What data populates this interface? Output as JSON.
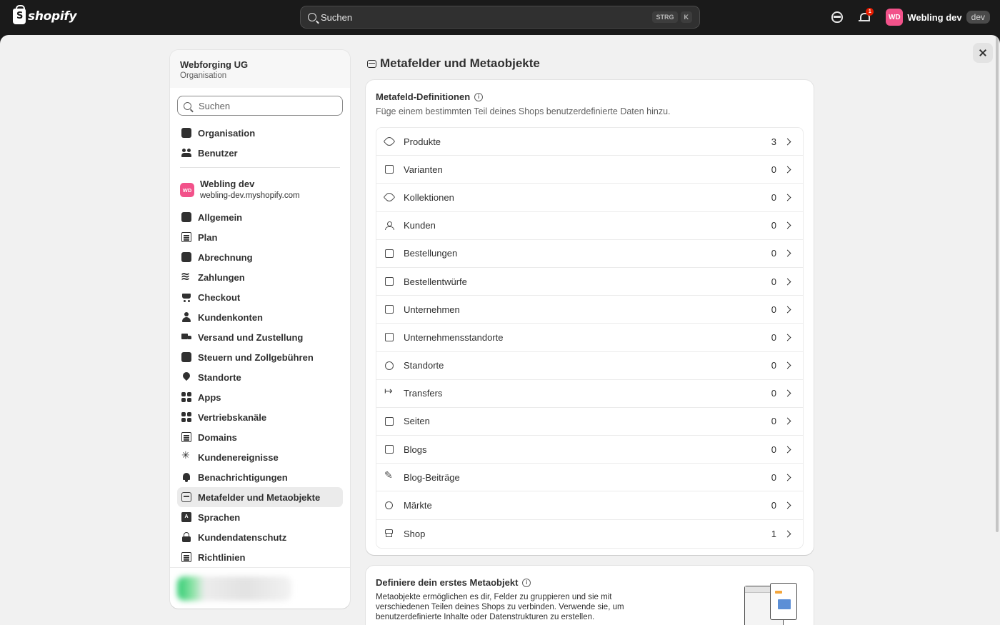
{
  "topbar": {
    "logo_text": "shopify",
    "search_placeholder": "Suchen",
    "shortcut_key1": "STRG",
    "shortcut_key2": "K",
    "notification_count": "1",
    "store_initials": "WD",
    "store_name": "Webling dev",
    "store_badge": "dev"
  },
  "sidebar": {
    "org_name": "Webforging UG",
    "org_sub": "Organisation",
    "search_placeholder": "Suchen",
    "org_items": [
      {
        "label": "Organisation",
        "icon": "building-icon"
      },
      {
        "label": "Benutzer",
        "icon": "users-icon"
      }
    ],
    "store": {
      "initials": "WD",
      "name": "Webling dev",
      "url": "webling-dev.myshopify.com"
    },
    "store_items": [
      {
        "label": "Allgemein",
        "icon": "store-icon"
      },
      {
        "label": "Plan",
        "icon": "plan-icon"
      },
      {
        "label": "Abrechnung",
        "icon": "billing-icon"
      },
      {
        "label": "Zahlungen",
        "icon": "payments-icon"
      },
      {
        "label": "Checkout",
        "icon": "cart-icon"
      },
      {
        "label": "Kundenkonten",
        "icon": "person-icon"
      },
      {
        "label": "Versand und Zustellung",
        "icon": "truck-icon"
      },
      {
        "label": "Steuern und Zollgebühren",
        "icon": "tax-icon"
      },
      {
        "label": "Standorte",
        "icon": "location-icon"
      },
      {
        "label": "Apps",
        "icon": "apps-icon"
      },
      {
        "label": "Vertriebskanäle",
        "icon": "channels-icon"
      },
      {
        "label": "Domains",
        "icon": "domains-icon"
      },
      {
        "label": "Kundenereignisse",
        "icon": "cursor-icon"
      },
      {
        "label": "Benachrichtigungen",
        "icon": "bell-icon"
      },
      {
        "label": "Metafelder und Metaobjekte",
        "icon": "metafields-icon"
      },
      {
        "label": "Sprachen",
        "icon": "language-icon"
      },
      {
        "label": "Kundendatenschutz",
        "icon": "lock-icon"
      },
      {
        "label": "Richtlinien",
        "icon": "policy-icon"
      }
    ]
  },
  "main": {
    "page_title": "Metafelder und Metaobjekte",
    "definitions": {
      "title": "Metafeld-Definitionen",
      "description": "Füge einem bestimmten Teil deines Shops benutzerdefinierte Daten hinzu.",
      "rows": [
        {
          "label": "Produkte",
          "count": "3",
          "icon": "tag-icon"
        },
        {
          "label": "Varianten",
          "count": "0",
          "icon": "variant-icon"
        },
        {
          "label": "Kollektionen",
          "count": "0",
          "icon": "collection-icon"
        },
        {
          "label": "Kunden",
          "count": "0",
          "icon": "person-icon"
        },
        {
          "label": "Bestellungen",
          "count": "0",
          "icon": "inbox-icon"
        },
        {
          "label": "Bestellentwürfe",
          "count": "0",
          "icon": "draft-icon"
        },
        {
          "label": "Unternehmen",
          "count": "0",
          "icon": "company-icon"
        },
        {
          "label": "Unternehmensstandorte",
          "count": "0",
          "icon": "company-location-icon"
        },
        {
          "label": "Standorte",
          "count": "0",
          "icon": "location-icon"
        },
        {
          "label": "Transfers",
          "count": "0",
          "icon": "transfer-icon"
        },
        {
          "label": "Seiten",
          "count": "0",
          "icon": "page-icon"
        },
        {
          "label": "Blogs",
          "count": "0",
          "icon": "blog-icon"
        },
        {
          "label": "Blog-Beiträge",
          "count": "0",
          "icon": "pencil-icon"
        },
        {
          "label": "Märkte",
          "count": "0",
          "icon": "globe-icon"
        },
        {
          "label": "Shop",
          "count": "1",
          "icon": "store-icon"
        }
      ]
    },
    "metaobject": {
      "title": "Definiere dein erstes Metaobjekt",
      "description": "Metaobjekte ermöglichen es dir, Felder zu gruppieren und sie mit verschiedenen Teilen deines Shops zu verbinden. Verwende sie, um benutzerdefinierte Inhalte oder Datenstrukturen zu erstellen."
    }
  }
}
